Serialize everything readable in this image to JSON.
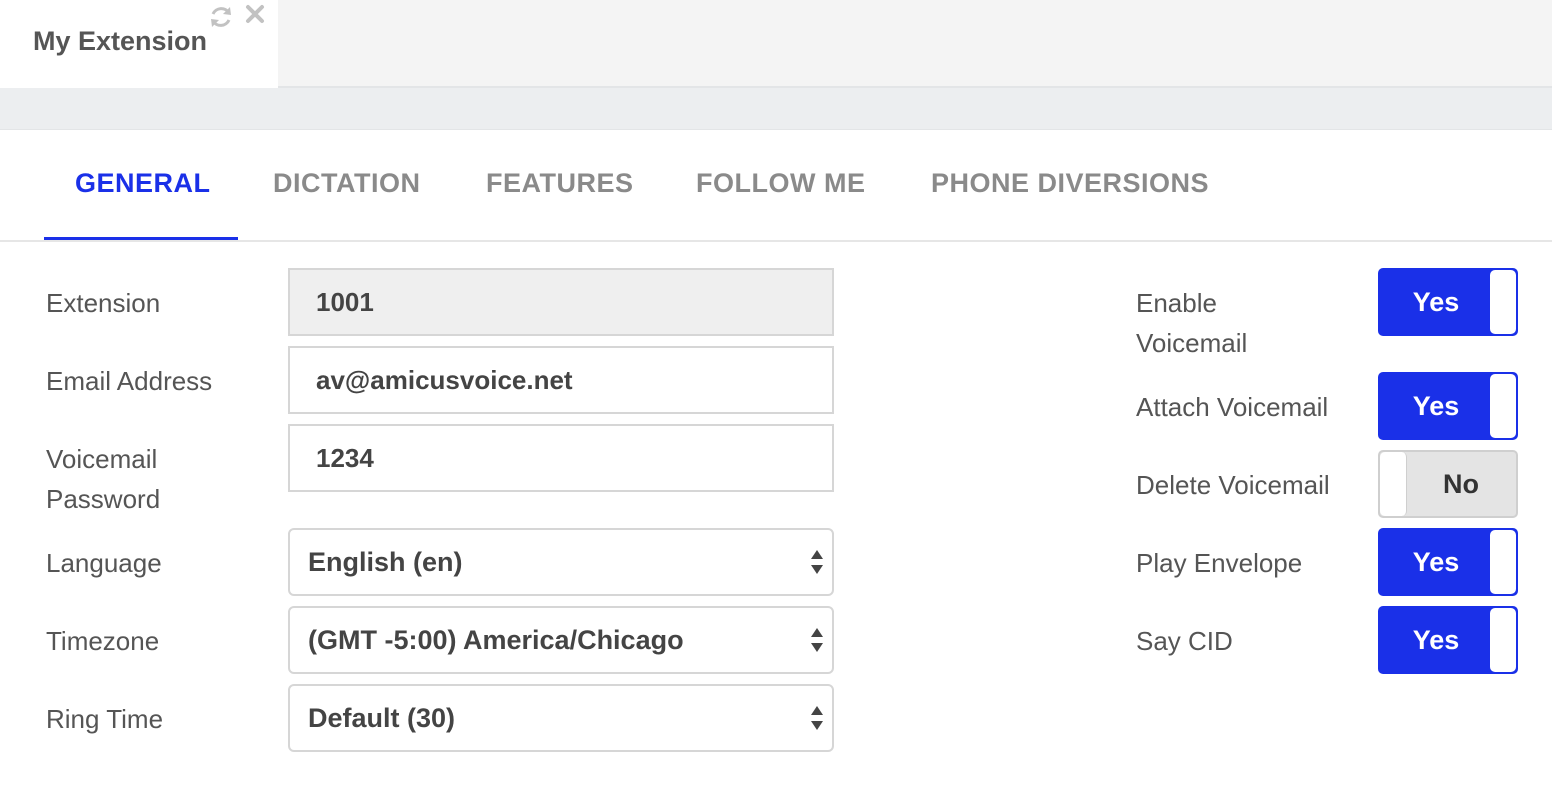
{
  "widget_tab": {
    "title": "My Extension",
    "refresh_icon": "refresh-icon",
    "close_icon": "close-icon"
  },
  "tabs": [
    {
      "label": "GENERAL",
      "active": true
    },
    {
      "label": "DICTATION",
      "active": false
    },
    {
      "label": "FEATURES",
      "active": false
    },
    {
      "label": "FOLLOW ME",
      "active": false
    },
    {
      "label": "PHONE DIVERSIONS",
      "active": false
    }
  ],
  "form": {
    "extension": {
      "label": "Extension",
      "value": "1001",
      "readonly": true
    },
    "email": {
      "label": "Email Address",
      "value": "av@amicusvoice.net"
    },
    "voicemail_password": {
      "label_line1": "Voicemail",
      "label_line2": "Password",
      "value": "1234"
    },
    "language": {
      "label": "Language",
      "value": "English (en)"
    },
    "timezone": {
      "label": "Timezone",
      "value": "(GMT -5:00) America/Chicago"
    },
    "ring_time": {
      "label": "Ring Time",
      "value": "Default (30)"
    }
  },
  "toggles": {
    "enable_voicemail": {
      "label_line1": "Enable",
      "label_line2": "Voicemail",
      "state": "Yes",
      "on": true
    },
    "attach_voicemail": {
      "label": "Attach Voicemail",
      "state": "Yes",
      "on": true
    },
    "delete_voicemail": {
      "label": "Delete Voicemail",
      "state": "No",
      "on": false
    },
    "play_envelope": {
      "label": "Play Envelope",
      "state": "Yes",
      "on": true
    },
    "say_cid": {
      "label": "Say CID",
      "state": "Yes",
      "on": true
    }
  },
  "colors": {
    "accent": "#1a30e8",
    "tab_inactive": "#8a8a8a",
    "text": "#555555"
  }
}
